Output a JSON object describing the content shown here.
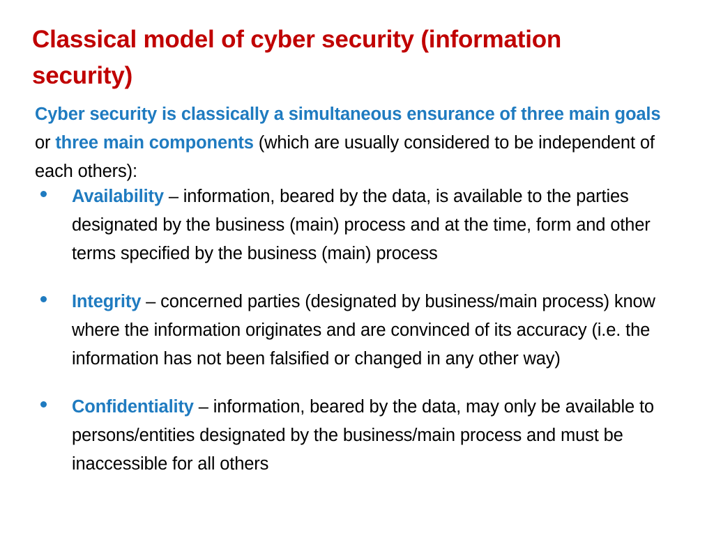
{
  "slide": {
    "title": "Classical model of cyber security (information security)",
    "background_color": "#FFFFFF",
    "title_color": "#C00000",
    "accent_color": "#1F7BC0",
    "body_color": "#000000"
  },
  "intro": {
    "segment_1": "Cyber security  is classically a simultaneous ensurance of three main goals",
    "segment_2": " or ",
    "segment_3": "three main components",
    "segment_4": " (which are usually considered to be independent of each others):"
  },
  "bullets": [
    {
      "marker": "bullet-dot",
      "term": "Availability",
      "dash": " – ",
      "description": "information, beared by the data, is available to the parties designated by the business (main) process and at the time, form and other terms specified by the business (main) process"
    },
    {
      "marker": "bullet-dot",
      "term": "Integrity",
      "dash": " – ",
      "description": "concerned parties (designated by business/main process) know where the information originates and are convinced of its accuracy (i.e. the information has not been falsified or changed in any other way)"
    },
    {
      "marker": "bullet-dot",
      "term": "Confidentiality",
      "dash": " – ",
      "description": "information, beared by the data, may only be available to persons/entities designated by the business/main process  and must be inaccessible for all others"
    }
  ]
}
